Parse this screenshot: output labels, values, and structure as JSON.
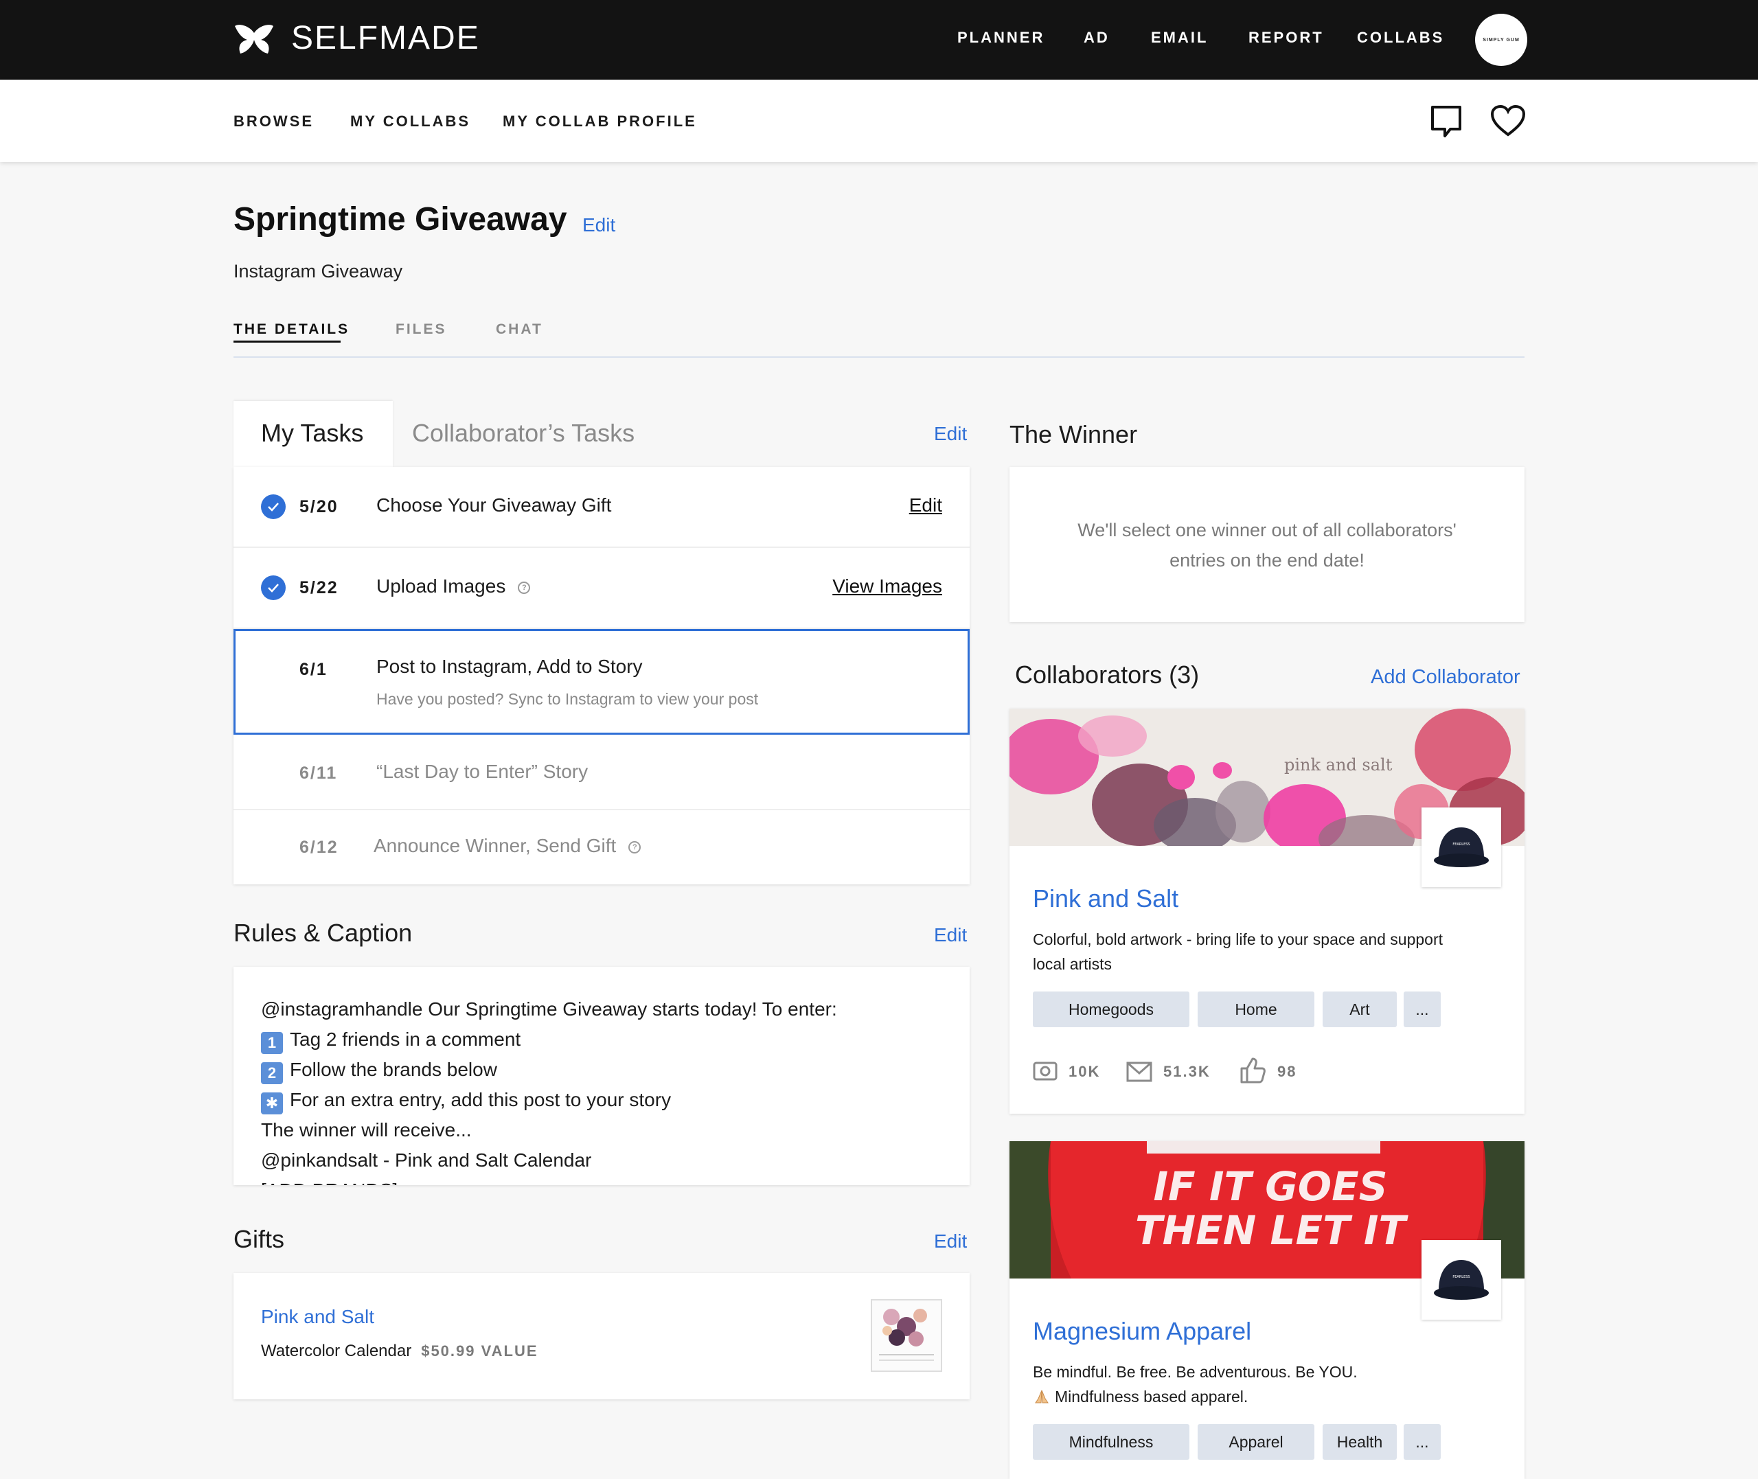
{
  "brand": {
    "name": "SELFMADE",
    "avatar_text": "SIMPLY GUM"
  },
  "topnav": [
    "PLANNER",
    "AD",
    "EMAIL",
    "REPORT",
    "COLLABS"
  ],
  "subnav": [
    "BROWSE",
    "MY COLLABS",
    "MY COLLAB PROFILE"
  ],
  "header": {
    "title": "Springtime Giveaway",
    "edit": "Edit",
    "subtitle": "Instagram Giveaway"
  },
  "tabs": [
    "THE DETAILS",
    "FILES",
    "CHAT"
  ],
  "tasks": {
    "tab_mine": "My Tasks",
    "tab_collab": "Collaborator’s Tasks",
    "edit": "Edit",
    "rows": [
      {
        "date": "5/20",
        "name": "Choose Your Giveaway Gift",
        "action": "Edit"
      },
      {
        "date": "5/22",
        "name": "Upload Images",
        "action": "View Images"
      },
      {
        "date": "6/1",
        "name": "Post to Instagram, Add to Story",
        "sub": "Have you posted? Sync to Instagram to view your post"
      },
      {
        "date": "6/11",
        "name": "“Last Day to Enter” Story"
      },
      {
        "date": "6/12",
        "name": "Announce Winner, Send Gift"
      }
    ]
  },
  "rules": {
    "title": "Rules & Caption",
    "edit": "Edit",
    "lines": [
      "@instagramhandle  Our Springtime Giveaway starts today! To enter:",
      "Tag 2 friends in a comment",
      "Follow the brands below",
      "For an extra entry, add this post to your story",
      "The winner will receive...",
      "@pinkandsalt - Pink and Salt Calendar",
      "[ADD BRANDS]"
    ],
    "markers": [
      "1",
      "2",
      "✱"
    ]
  },
  "gifts": {
    "title": "Gifts",
    "edit": "Edit",
    "brand": "Pink and Salt",
    "item": "Watercolor Calendar",
    "value": "$50.99 VALUE"
  },
  "winner": {
    "title": "The Winner",
    "text_1": "We'll select one winner out of all collaborators'",
    "text_2": "entries on the end date!"
  },
  "collaborators": {
    "title": "Collaborators (3)",
    "add": "Add Collaborator",
    "items": [
      {
        "banner_text": "pink and salt",
        "name": "Pink and Salt",
        "desc_1": "Colorful, bold artwork - bring life to your space and support",
        "desc_2": "local artists",
        "tags": [
          "Homegoods",
          "Home",
          "Art",
          "..."
        ],
        "stats": {
          "instagram": "10K",
          "email": "51.3K",
          "likes": "98"
        },
        "badge_text": "FEARLESS"
      },
      {
        "banner_text_1": "IF IT GOES",
        "banner_text_2": "THEN LET IT",
        "name": "Magnesium Apparel",
        "desc_1": "Be mindful. Be free. Be adventurous. Be YOU.",
        "desc_2": "Mindfulness based apparel.",
        "tags": [
          "Mindfulness",
          "Apparel",
          "Health",
          "..."
        ],
        "badge_text": "FEARLESS"
      }
    ]
  },
  "colors": {
    "accent": "#2f6fd6",
    "topbar": "#131313",
    "chip": "#dde3ec"
  }
}
